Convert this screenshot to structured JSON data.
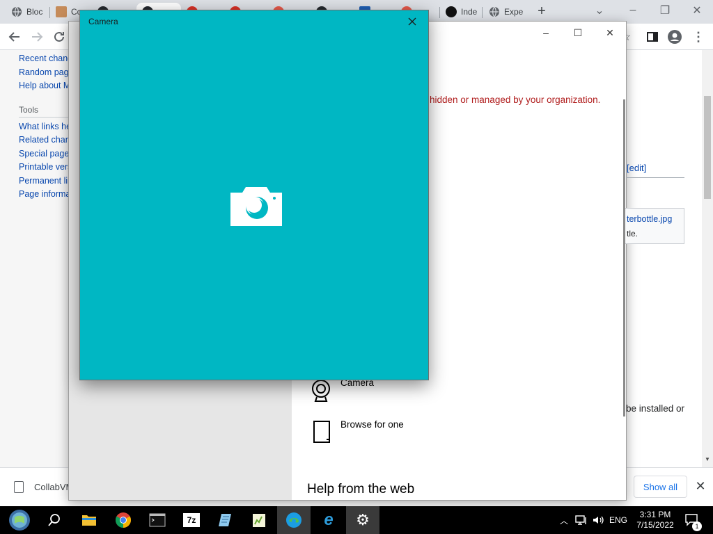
{
  "browser": {
    "tabs": [
      {
        "label": "Bloc",
        "icon": "globe-icon"
      },
      {
        "label": "Co",
        "icon": "avatar-favicon-icon"
      },
      {
        "label": "",
        "icon": "github-icon"
      },
      {
        "label": "",
        "icon": "github-icon"
      },
      {
        "label": "",
        "icon": "red-circle-icon"
      },
      {
        "label": "",
        "icon": "red-circle-icon"
      },
      {
        "label": "",
        "icon": "red-circle-icon"
      },
      {
        "label": "",
        "icon": "github-icon"
      },
      {
        "label": "",
        "icon": "k-logo-icon"
      },
      {
        "label": "",
        "icon": "red-circle-icon"
      },
      {
        "label": "Inde",
        "icon": "wikimedia-icon"
      },
      {
        "label": "Expe",
        "icon": "globe-icon"
      }
    ],
    "new_tab_label": "+"
  },
  "wiki": {
    "sidebar_links_top": [
      "Recent changes",
      "Random page",
      "Help about MediaWiki"
    ],
    "tools_heading": "Tools",
    "tools_links": [
      "What links here",
      "Related changes",
      "Special pages",
      "Printable version",
      "Permanent link",
      "Page information"
    ],
    "org_notice": "hidden or managed by your organization.",
    "edit_link": "[edit]",
    "file_link": "terbottle.jpg",
    "file_caption": "tle.",
    "side_text": "be installed or"
  },
  "settings_dialog": {
    "options": [
      {
        "label": "Camera",
        "icon": "webcam-icon"
      },
      {
        "label": "Browse for one",
        "icon": "file-icon"
      }
    ],
    "help_heading": "Help from the web"
  },
  "camera_window": {
    "title": "Camera",
    "accent": "#00b7c3"
  },
  "download_bar": {
    "file_name": "CollabVM",
    "show_all_label": "Show all"
  },
  "taskbar": {
    "language": "ENG",
    "time": "3:31 PM",
    "date": "7/15/2022",
    "notification_count": "1"
  }
}
